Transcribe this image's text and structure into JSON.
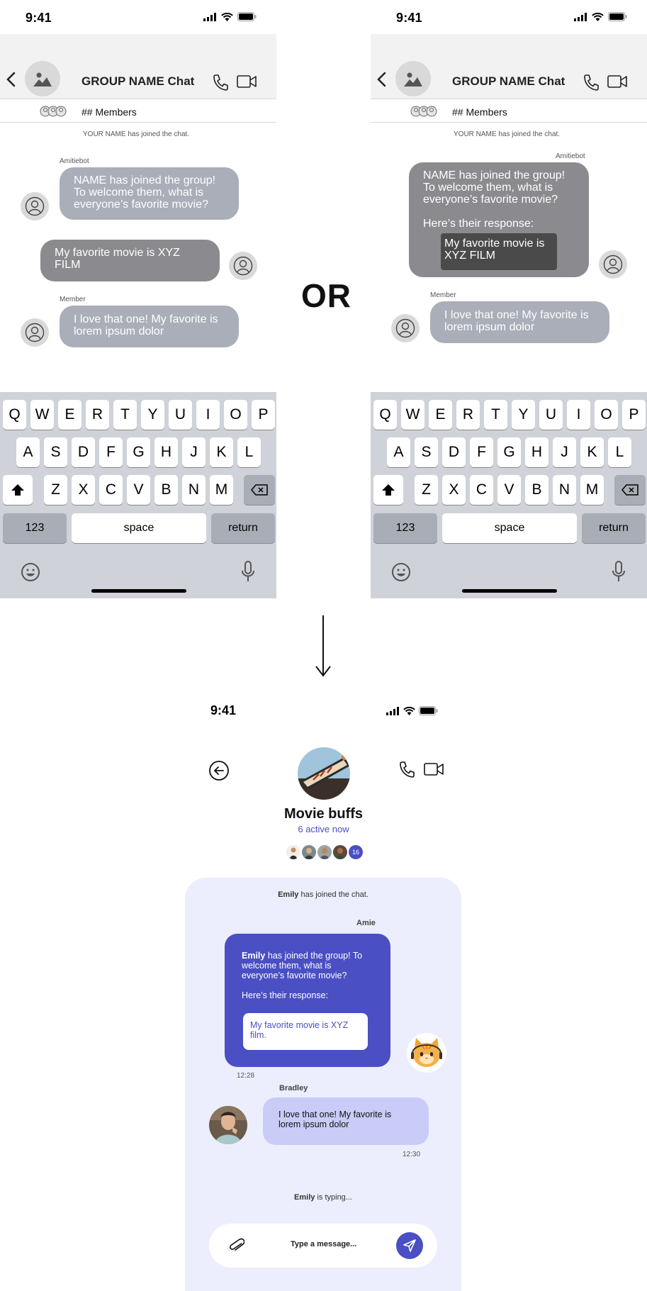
{
  "left_screen": {
    "status_time": "9:41",
    "header": {
      "title": "GROUP NAME Chat"
    },
    "members_label": "## Members",
    "system_message": "YOUR NAME has joined the chat.",
    "messages": [
      {
        "sender": "Amitiebot",
        "text": "NAME has joined the group! To welcome them, what is everyone’s favorite movie?"
      },
      {
        "sender": "",
        "text": "My favorite movie is XYZ FILM"
      },
      {
        "sender": "Member",
        "text": "I love that one! My favorite is lorem ipsum dolor"
      }
    ]
  },
  "right_screen": {
    "status_time": "9:41",
    "header": {
      "title": "GROUP NAME Chat"
    },
    "members_label": "## Members",
    "system_message": "YOUR NAME has joined the chat.",
    "bot_sender": "Amitiebot",
    "bot_message": "NAME has joined the group! To welcome them, what is everyone’s favorite movie?",
    "bot_response_label": "Here’s their response:",
    "quoted_response": "My favorite movie is XYZ FILM",
    "member_sender": "Member",
    "member_message": "I love that one! My favorite is lorem ipsum dolor"
  },
  "keyboard": {
    "row1": [
      "Q",
      "W",
      "E",
      "R",
      "T",
      "Y",
      "U",
      "I",
      "O",
      "P"
    ],
    "row2": [
      "A",
      "S",
      "D",
      "F",
      "G",
      "H",
      "J",
      "K",
      "L"
    ],
    "row3": [
      "Z",
      "X",
      "C",
      "V",
      "B",
      "N",
      "M"
    ],
    "numbers_label": "123",
    "space_label": "space",
    "return_label": "return"
  },
  "divider_text": "OR",
  "final_screen": {
    "status_time": "9:41",
    "group_name": "Movie buffs",
    "active_status": "6 active now",
    "member_count_badge": "16",
    "join_name": "Emily",
    "join_text": " has joined the chat.",
    "bot_sender": "Amie",
    "bot_message_name": "Emily",
    "bot_message_rest": " has joined the group! To welcome them, what is everyone’s favorite movie?",
    "bot_response_label": "Here’s their response:",
    "quoted_response": "My favorite movie is XYZ film.",
    "bot_time": "12:28",
    "user_sender": "Bradley",
    "user_message": "I love that one! My favorite is lorem ipsum dolor",
    "user_time": "12:30",
    "typing_name": "Emily",
    "typing_text": " is typing...",
    "input_placeholder": "Type a message...",
    "accent_color": "#4a4fc4",
    "panel_color": "#eceefd",
    "user_bubble_color": "#c9ccf7"
  }
}
